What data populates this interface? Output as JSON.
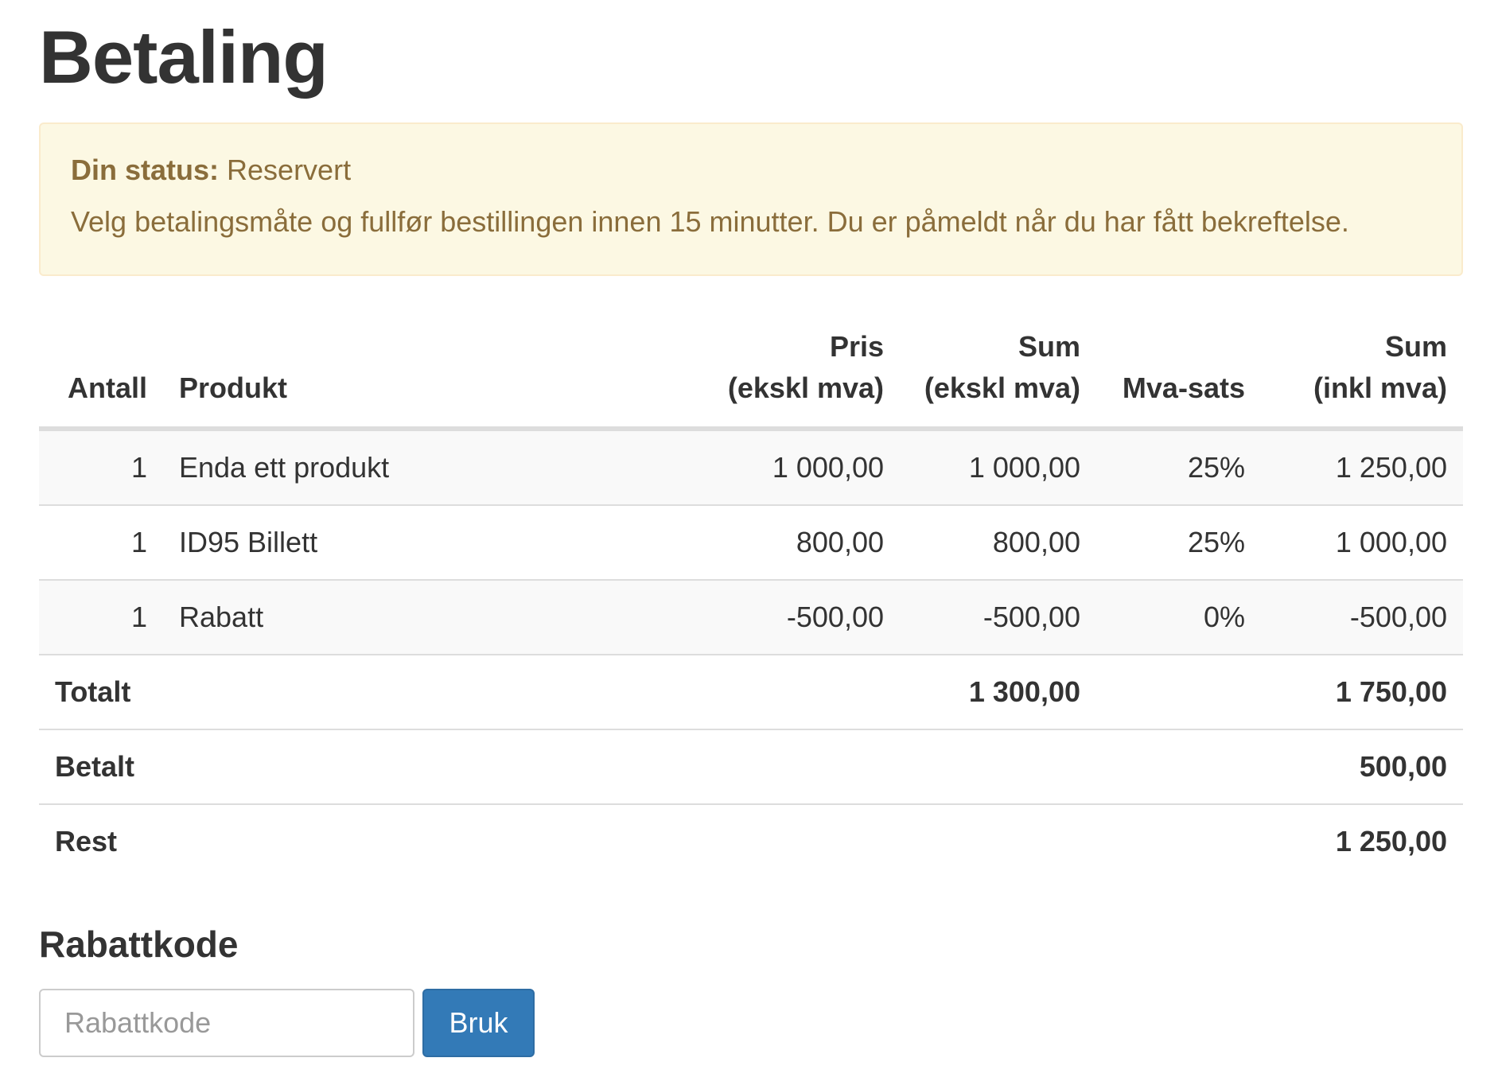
{
  "page": {
    "title": "Betaling"
  },
  "status_alert": {
    "label": "Din status:",
    "value": "Reservert",
    "message": "Velg betalingsmåte og fullfør bestillingen innen 15 minutter. Du er påmeldt når du har fått bekreftelse."
  },
  "cart": {
    "headers": {
      "quantity": "Antall",
      "product": "Produkt",
      "price_line1": "Pris",
      "price_line2": "(ekskl mva)",
      "sum_ex_line1": "Sum",
      "sum_ex_line2": "(ekskl mva)",
      "vat_rate": "Mva-sats",
      "sum_inc_line1": "Sum",
      "sum_inc_line2": "(inkl mva)"
    },
    "rows": [
      {
        "quantity": "1",
        "product": "Enda ett produkt",
        "price": "1 000,00",
        "sum_ex": "1 000,00",
        "vat_rate": "25%",
        "sum_inc": "1 250,00"
      },
      {
        "quantity": "1",
        "product": "ID95 Billett",
        "price": "800,00",
        "sum_ex": "800,00",
        "vat_rate": "25%",
        "sum_inc": "1 000,00"
      },
      {
        "quantity": "1",
        "product": "Rabatt",
        "price": "-500,00",
        "sum_ex": "-500,00",
        "vat_rate": "0%",
        "sum_inc": "-500,00"
      }
    ],
    "totals": {
      "total_label": "Totalt",
      "total_ex": "1 300,00",
      "total_inc": "1 750,00",
      "paid_label": "Betalt",
      "paid": "500,00",
      "rest_label": "Rest",
      "rest": "1 250,00"
    }
  },
  "coupon": {
    "title": "Rabattkode",
    "placeholder": "Rabattkode",
    "value": "",
    "button_label": "Bruk"
  },
  "colors": {
    "alert_background": "#fcf8e3",
    "alert_text": "#8a6d3b",
    "primary_button": "#337ab7"
  }
}
